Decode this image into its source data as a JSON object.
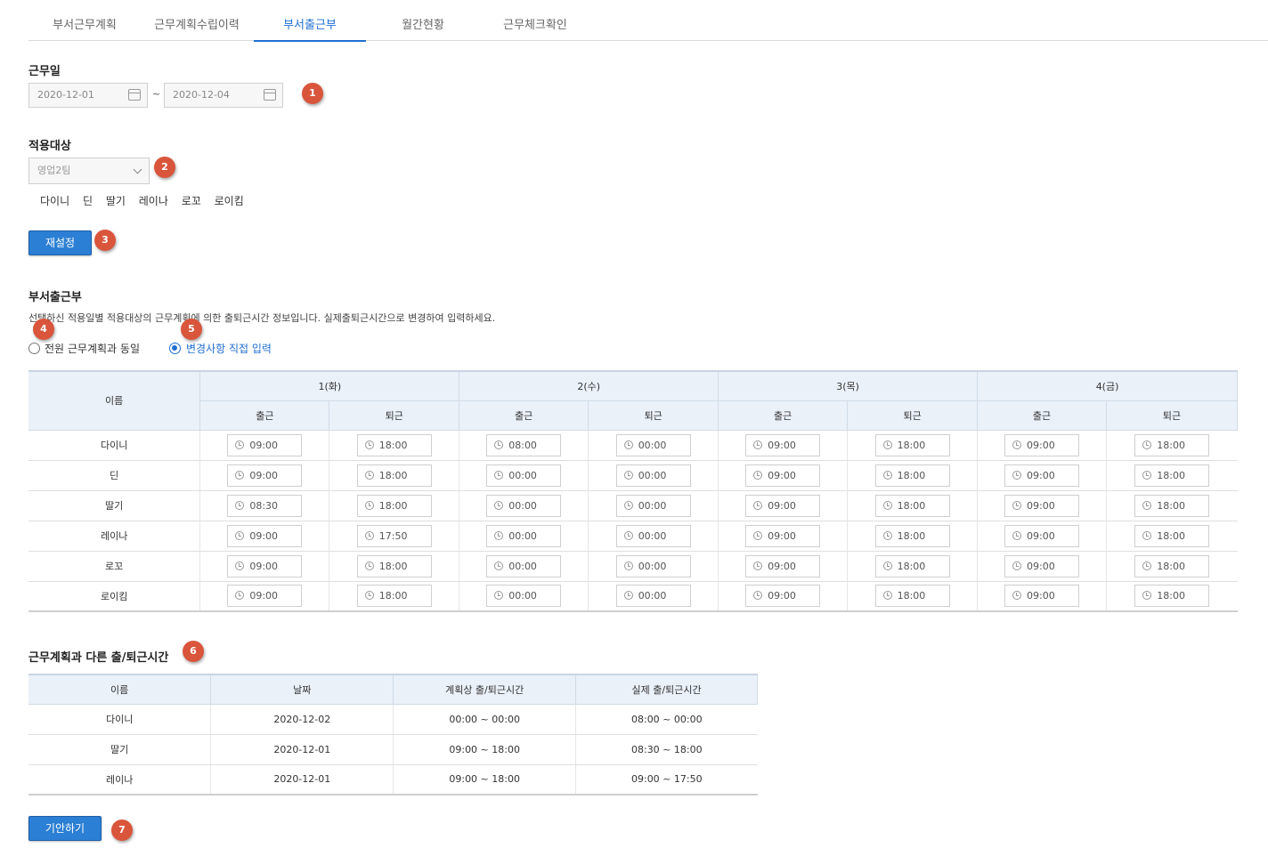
{
  "tabs": [
    {
      "label": "부서근무계획"
    },
    {
      "label": "근무계획수립이력"
    },
    {
      "label": "부서출근부"
    },
    {
      "label": "월간현황"
    },
    {
      "label": "근무체크확인"
    }
  ],
  "work_date": {
    "title": "근무일",
    "start": "2020-12-01",
    "end": "2020-12-04",
    "separator": "~"
  },
  "target": {
    "title": "적용대상",
    "selected": "영업2팀",
    "members": [
      "다이니",
      "딘",
      "딸기",
      "레이나",
      "로꼬",
      "로이킴"
    ],
    "reset_label": "재설정"
  },
  "attendance": {
    "title": "부서출근부",
    "description": "선택하신 적용일별 적용대상의 근무계획에 의한 출퇴근시간 정보입니다. 실제출퇴근시간으로 변경하여 입력하세요.",
    "radio_same": "전원 근무계획과 동일",
    "radio_direct": "변경사항 직접 입력",
    "name_header": "이름",
    "in_label": "출근",
    "out_label": "퇴근",
    "days": [
      "1(화)",
      "2(수)",
      "3(목)",
      "4(금)"
    ],
    "rows": [
      {
        "name": "다이니",
        "times": [
          "09:00",
          "18:00",
          "08:00",
          "00:00",
          "09:00",
          "18:00",
          "09:00",
          "18:00"
        ]
      },
      {
        "name": "딘",
        "times": [
          "09:00",
          "18:00",
          "00:00",
          "00:00",
          "09:00",
          "18:00",
          "09:00",
          "18:00"
        ]
      },
      {
        "name": "딸기",
        "times": [
          "08:30",
          "18:00",
          "00:00",
          "00:00",
          "09:00",
          "18:00",
          "09:00",
          "18:00"
        ]
      },
      {
        "name": "레이나",
        "times": [
          "09:00",
          "17:50",
          "00:00",
          "00:00",
          "09:00",
          "18:00",
          "09:00",
          "18:00"
        ]
      },
      {
        "name": "로꼬",
        "times": [
          "09:00",
          "18:00",
          "00:00",
          "00:00",
          "09:00",
          "18:00",
          "09:00",
          "18:00"
        ]
      },
      {
        "name": "로이킴",
        "times": [
          "09:00",
          "18:00",
          "00:00",
          "00:00",
          "09:00",
          "18:00",
          "09:00",
          "18:00"
        ]
      }
    ]
  },
  "diff": {
    "title": "근무계획과 다른 출/퇴근시간",
    "headers": [
      "이름",
      "날짜",
      "계획상 출/퇴근시간",
      "실제 출/퇴근시간"
    ],
    "rows": [
      [
        "다이니",
        "2020-12-02",
        "00:00 ~ 00:00",
        "08:00 ~ 00:00"
      ],
      [
        "딸기",
        "2020-12-01",
        "09:00 ~ 18:00",
        "08:30 ~ 18:00"
      ],
      [
        "레이나",
        "2020-12-01",
        "09:00 ~ 18:00",
        "09:00 ~ 17:50"
      ]
    ]
  },
  "submit_label": "기안하기",
  "badges": [
    "1",
    "2",
    "3",
    "4",
    "5",
    "6",
    "7"
  ],
  "colors": {
    "accent": "#2b7fd4",
    "badge": "#d9553b",
    "header_bg": "#eaf1f9"
  }
}
